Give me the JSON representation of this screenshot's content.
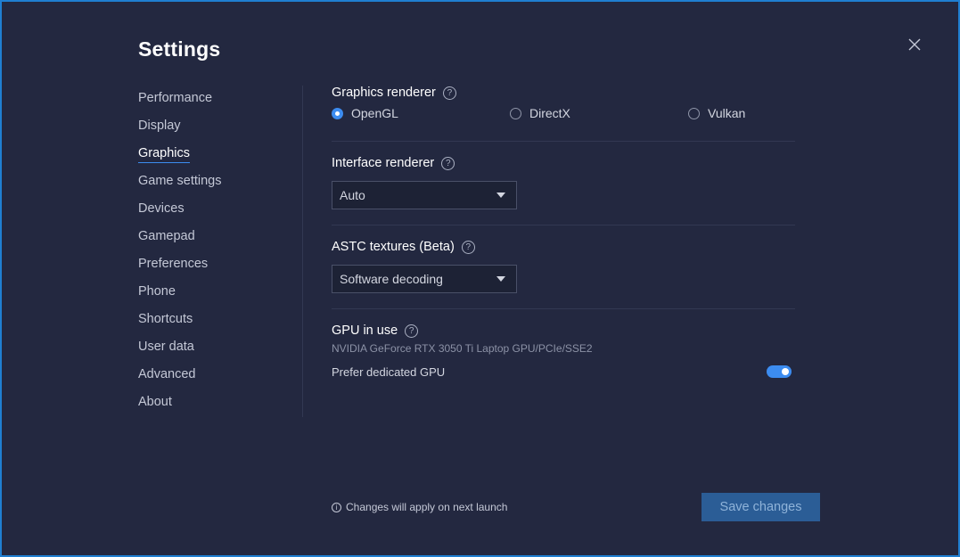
{
  "window": {
    "title": "Settings"
  },
  "icons": {
    "close": "close-icon",
    "help": "help-circle-icon",
    "info": "info-circle-icon",
    "caret": "chevron-down-icon"
  },
  "colors": {
    "accent": "#3c8cf0",
    "background": "#232840",
    "border": "#1f7fd1",
    "save_button": "#2b5d96"
  },
  "sidebar": {
    "active": "Graphics",
    "items": [
      {
        "label": "Performance"
      },
      {
        "label": "Display"
      },
      {
        "label": "Graphics"
      },
      {
        "label": "Game settings"
      },
      {
        "label": "Devices"
      },
      {
        "label": "Gamepad"
      },
      {
        "label": "Preferences"
      },
      {
        "label": "Phone"
      },
      {
        "label": "Shortcuts"
      },
      {
        "label": "User data"
      },
      {
        "label": "Advanced"
      },
      {
        "label": "About"
      }
    ]
  },
  "graphics_renderer": {
    "title": "Graphics renderer",
    "help": "?",
    "selected": "OpenGL",
    "options": [
      {
        "label": "OpenGL"
      },
      {
        "label": "DirectX"
      },
      {
        "label": "Vulkan"
      }
    ]
  },
  "interface_renderer": {
    "title": "Interface renderer",
    "help": "?",
    "value": "Auto"
  },
  "astc_textures": {
    "title": "ASTC textures (Beta)",
    "help": "?",
    "value": "Software decoding"
  },
  "gpu": {
    "title": "GPU in use",
    "help": "?",
    "name": "NVIDIA GeForce RTX 3050 Ti Laptop GPU/PCIe/SSE2",
    "prefer_label": "Prefer dedicated GPU",
    "prefer_enabled": true
  },
  "footer": {
    "info_glyph": "i",
    "note": "Changes will apply on next launch",
    "save_label": "Save changes"
  }
}
